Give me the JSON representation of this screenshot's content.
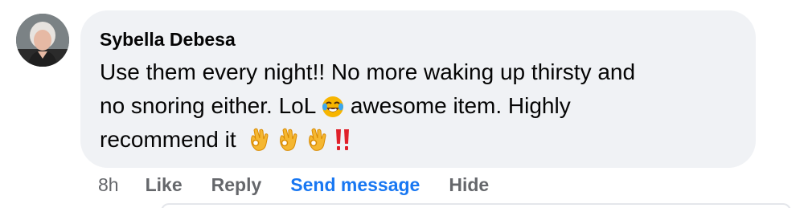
{
  "comment": {
    "author": "Sybella Debesa",
    "text_line1": "Use them every night!! No more waking up thirsty and",
    "text_line2": "no snoring either. LoL",
    "text_line2b": " awesome item. Highly",
    "text_line3": "recommend it",
    "emojis": [
      "face-with-tears-of-joy-icon",
      "ok-hand-icon",
      "ok-hand-icon",
      "ok-hand-icon",
      "double-exclamation-icon"
    ],
    "accent_color": "#1877f2",
    "bubble_color": "#f0f2f5"
  },
  "actions": {
    "time": "8h",
    "like": "Like",
    "reply": "Reply",
    "send_message": "Send message",
    "hide": "Hide"
  }
}
